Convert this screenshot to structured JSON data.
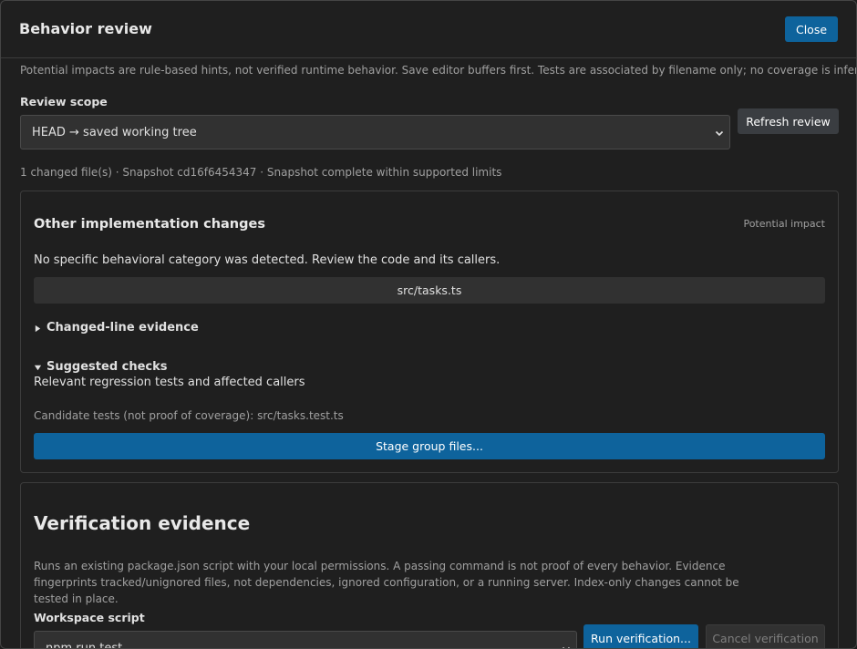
{
  "dialog": {
    "title": "Behavior review",
    "close_label": "Close",
    "notice": "Potential impacts are rule-based hints, not verified runtime behavior. Save editor buffers first. Tests are associated by filename only; no coverage is inferred."
  },
  "review_scope": {
    "label": "Review scope",
    "selected": "HEAD → saved working tree",
    "refresh_label": "Refresh review",
    "snapshot_line": "1 changed file(s) · Snapshot cd16f6454347 · Snapshot complete within supported limits"
  },
  "group": {
    "title": "Other implementation changes",
    "impact_badge": "Potential impact",
    "description": "No specific behavioral category was detected. Review the code and its callers.",
    "file": "src/tasks.ts",
    "evidence_summary": "Changed-line evidence",
    "checks_summary": "Suggested checks",
    "checks_text": "Relevant regression tests and affected callers",
    "candidate_tests": "Candidate tests (not proof of coverage): src/tasks.test.ts",
    "stage_label": "Stage group files..."
  },
  "verification": {
    "title": "Verification evidence",
    "description": "Runs an existing package.json script with your local permissions. A passing command is not proof of every behavior. Evidence fingerprints tracked/unignored files, not dependencies, ignored configuration, or a running server. Index-only changes cannot be tested in place.",
    "script_label": "Workspace script",
    "script_selected": "npm run test",
    "run_label": "Run verification...",
    "cancel_label": "Cancel verification"
  },
  "icons": {
    "select_chevron": "chevron-down-icon",
    "collapsed_triangle": "triangle-right-icon",
    "expanded_triangle": "triangle-down-icon"
  },
  "colors": {
    "primary_button": "#0e639c",
    "secondary_button": "#3a3d41",
    "background": "#1f1f1f"
  }
}
